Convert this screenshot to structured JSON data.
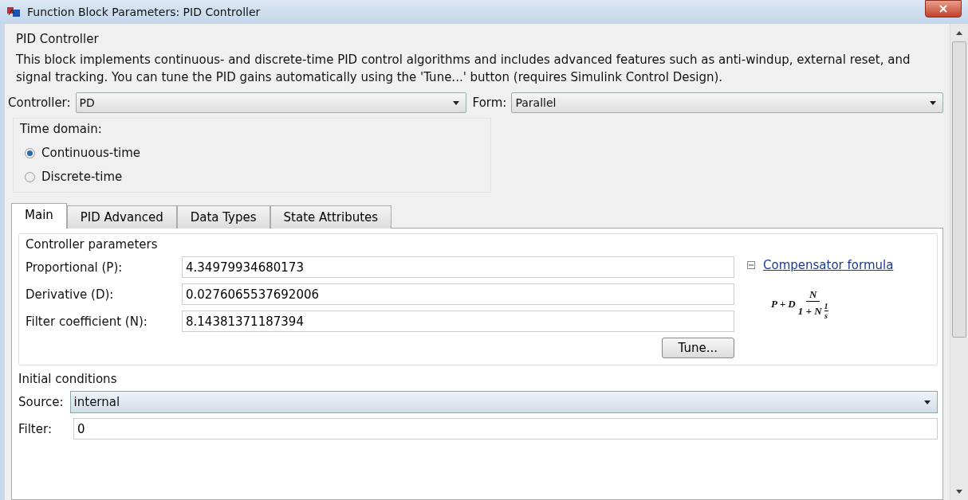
{
  "window": {
    "title": "Function Block Parameters: PID Controller"
  },
  "block": {
    "name": "PID Controller",
    "description": "This block implements continuous- and discrete-time PID control algorithms and includes advanced features such as anti-windup, external reset, and signal tracking. You can tune the PID gains automatically using the 'Tune...' button (requires Simulink Control Design)."
  },
  "controller": {
    "label": "Controller:",
    "value": "PD"
  },
  "form": {
    "label": "Form:",
    "value": "Parallel"
  },
  "time_domain": {
    "title": "Time domain:",
    "options": [
      {
        "label": "Continuous-time",
        "selected": true
      },
      {
        "label": "Discrete-time",
        "selected": false
      }
    ]
  },
  "tabs": [
    {
      "label": "Main",
      "selected": true
    },
    {
      "label": "PID Advanced",
      "selected": false
    },
    {
      "label": "Data Types",
      "selected": false
    },
    {
      "label": "State Attributes",
      "selected": false
    }
  ],
  "controller_parameters": {
    "title": "Controller parameters",
    "fields": [
      {
        "label": "Proportional (P):",
        "value": "4.34979934680173"
      },
      {
        "label": "Derivative (D):",
        "value": "0.0276065537692006"
      },
      {
        "label": "Filter coefficient (N):",
        "value": "8.14381371187394"
      }
    ],
    "tune_button": "Tune...",
    "formula_link": "Compensator formula",
    "formula_expanded": true,
    "formula": {
      "lead": "P + D",
      "numerator": "N",
      "denominator": "1 + N",
      "inner_numerator": "1",
      "inner_denominator": "s"
    }
  },
  "initial_conditions": {
    "title": "Initial conditions",
    "source": {
      "label": "Source:",
      "value": "internal"
    },
    "filter": {
      "label": "Filter:",
      "value": "0"
    }
  }
}
